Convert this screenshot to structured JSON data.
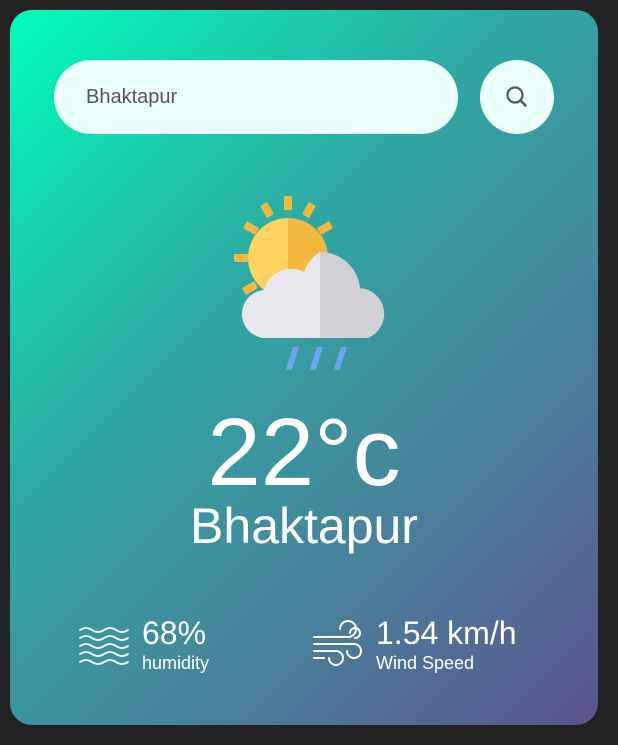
{
  "search": {
    "value": "Bhaktapur",
    "button_icon": "search-icon"
  },
  "weather": {
    "icon": "sun-cloud-rain-icon",
    "temperature": "22°c",
    "city": "Bhaktapur"
  },
  "details": {
    "humidity": {
      "value": "68%",
      "label": "humidity",
      "icon": "waves-icon"
    },
    "wind": {
      "value": "1.54 km/h",
      "label": "Wind Speed",
      "icon": "wind-icon"
    }
  },
  "colors": {
    "gradient_start": "#00feba",
    "gradient_end": "#5b548f",
    "input_bg": "#ebfffc",
    "sun": "#fbc640",
    "cloud": "#e6e5eb",
    "rain": "#6aa6f0"
  }
}
